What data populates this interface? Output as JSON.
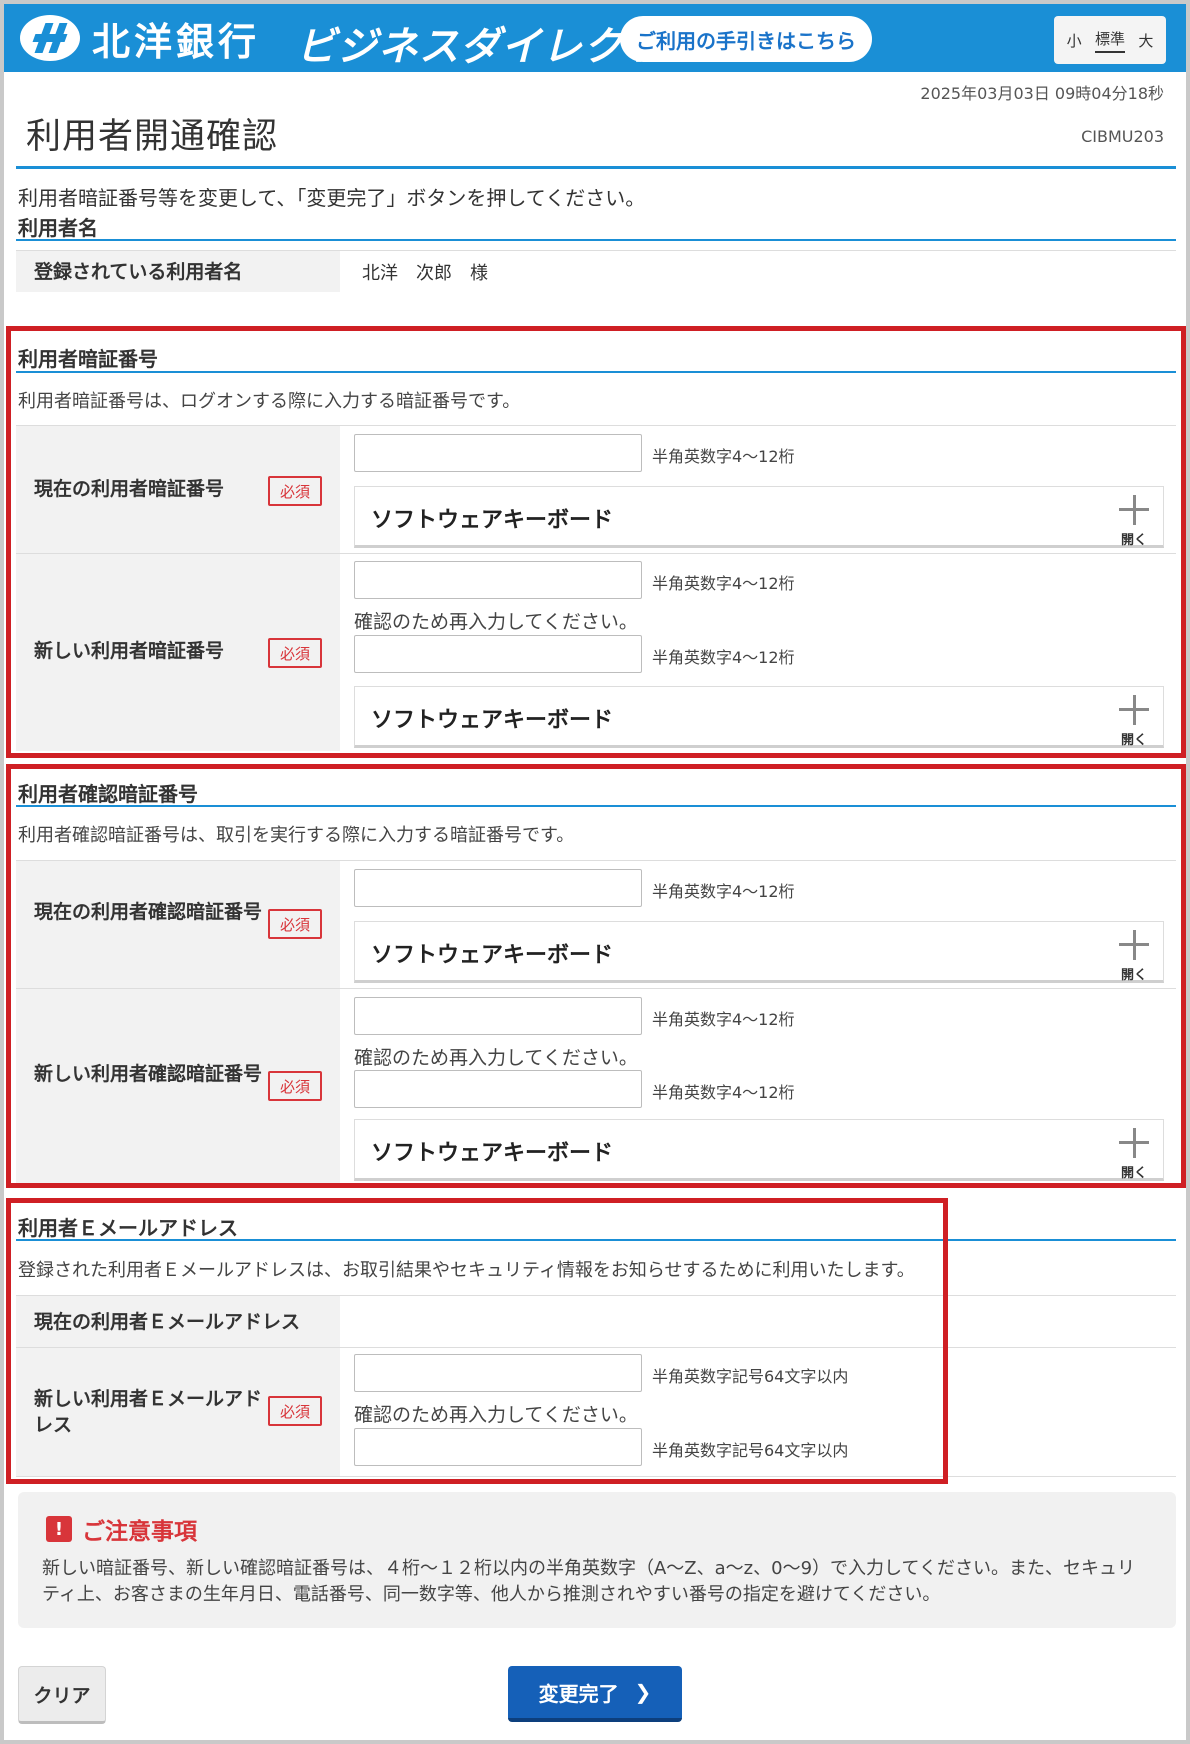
{
  "header": {
    "bank_name": "北洋銀行",
    "service_name": "ビジネスダイレクト",
    "guide_link": "ご利用の手引きはこちら",
    "font_sizes": [
      "小",
      "標準",
      "大"
    ],
    "font_size_selected": "標準",
    "brand_color": "#1a8fd6"
  },
  "timestamp": "2025年03月03日 09時04分18秒",
  "page_title": "利用者開通確認",
  "screen_id": "CIBMU203",
  "instruction": "利用者暗証番号等を変更して、「変更完了」ボタンを押してください。",
  "user_name_section": {
    "heading": "利用者名",
    "label": "登録されている利用者名",
    "value": "北洋　次郎　様"
  },
  "required_label": "必須",
  "keyboard_label": "ソフトウェアキーボード",
  "keyboard_open": "開く",
  "reenter_text": "確認のため再入力してください。",
  "password_section": {
    "heading": "利用者暗証番号",
    "description": "利用者暗証番号は、ログオンする際に入力する暗証番号です。",
    "current_label": "現在の利用者暗証番号",
    "new_label": "新しい利用者暗証番号",
    "hint": "半角英数字4～12桁"
  },
  "confirm_password_section": {
    "heading": "利用者確認暗証番号",
    "description": "利用者確認暗証番号は、取引を実行する際に入力する暗証番号です。",
    "current_label": "現在の利用者確認暗証番号",
    "new_label": "新しい利用者確認暗証番号",
    "hint": "半角英数字4～12桁"
  },
  "email_section": {
    "heading": "利用者Ｅメールアドレス",
    "description": "登録された利用者Ｅメールアドレスは、お取引結果やセキュリティ情報をお知らせするために利用いたします。",
    "current_label": "現在の利用者Ｅメールアドレス",
    "current_value": "",
    "new_label": "新しい利用者Ｅメールアドレス",
    "hint": "半角英数字記号64文字以内"
  },
  "notice": {
    "icon": "!",
    "title": "ご注意事項",
    "text": "新しい暗証番号、新しい確認暗証番号は、４桁～１２桁以内の半角英数字（A～Z、a～z、0～9）で入力してください。また、セキュリティ上、お客さまの生年月日、電話番号、同一数字等、他人から推測されやすい番号の指定を避けてください。"
  },
  "buttons": {
    "clear": "クリア",
    "done": "変更完了"
  }
}
